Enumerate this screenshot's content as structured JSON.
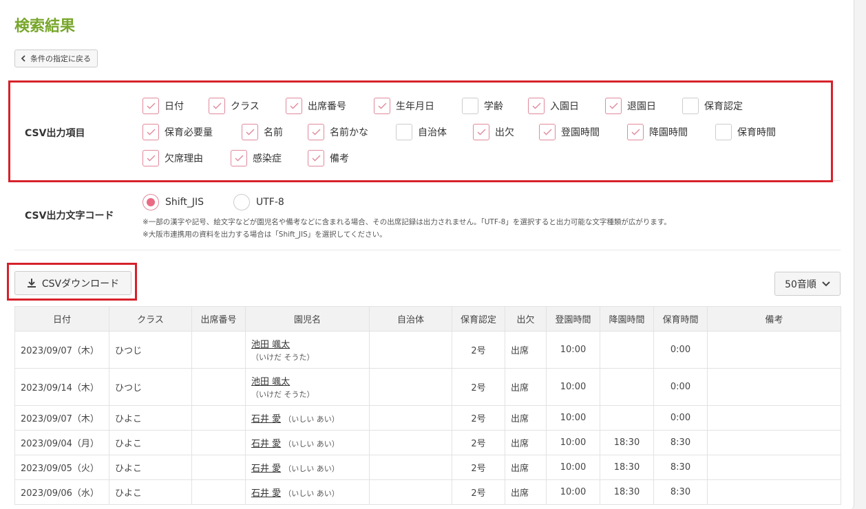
{
  "title": "検索結果",
  "back_label": "条件の指定に戻る",
  "csv_items": {
    "label": "CSV出力項目",
    "items": [
      {
        "label": "日付",
        "checked": true
      },
      {
        "label": "クラス",
        "checked": true
      },
      {
        "label": "出席番号",
        "checked": true
      },
      {
        "label": "生年月日",
        "checked": true
      },
      {
        "label": "学齢",
        "checked": false
      },
      {
        "label": "入園日",
        "checked": true
      },
      {
        "label": "退園日",
        "checked": true
      },
      {
        "label": "保育認定",
        "checked": false
      },
      {
        "label": "保育必要量",
        "checked": true
      },
      {
        "label": "名前",
        "checked": true
      },
      {
        "label": "名前かな",
        "checked": true
      },
      {
        "label": "自治体",
        "checked": false
      },
      {
        "label": "出欠",
        "checked": true
      },
      {
        "label": "登園時間",
        "checked": true
      },
      {
        "label": "降園時間",
        "checked": true
      },
      {
        "label": "保育時間",
        "checked": false
      },
      {
        "label": "欠席理由",
        "checked": true
      },
      {
        "label": "感染症",
        "checked": true
      },
      {
        "label": "備考",
        "checked": true
      }
    ]
  },
  "encoding": {
    "label": "CSV出力文字コード",
    "options": [
      {
        "label": "Shift_JIS",
        "selected": true
      },
      {
        "label": "UTF-8",
        "selected": false
      }
    ],
    "note1": "※一部の漢字や記号、絵文字などが園児名や備考などに含まれる場合、その出席記録は出力されません。「UTF-8」を選択すると出力可能な文字種類が広がります。",
    "note2": "※大阪市連携用の資料を出力する場合は「Shift_JIS」を選択してください。"
  },
  "download_label": "CSVダウンロード",
  "sort_label": "50音順",
  "table": {
    "headers": [
      "日付",
      "クラス",
      "出席番号",
      "園児名",
      "自治体",
      "保育認定",
      "出欠",
      "登園時間",
      "降園時間",
      "保育時間",
      "備考"
    ],
    "rows": [
      {
        "date": "2023/09/07（木）",
        "class": "ひつじ",
        "number": "",
        "name": "池田 颯太",
        "kana": "（いけだ そうた）",
        "city": "",
        "cert": "2号",
        "attendance": "出席",
        "arrive": "10:00",
        "leave": "",
        "hours": "0:00",
        "note": ""
      },
      {
        "date": "2023/09/14（木）",
        "class": "ひつじ",
        "number": "",
        "name": "池田 颯太",
        "kana": "（いけだ そうた）",
        "city": "",
        "cert": "2号",
        "attendance": "出席",
        "arrive": "10:00",
        "leave": "",
        "hours": "0:00",
        "note": ""
      },
      {
        "date": "2023/09/07（木）",
        "class": "ひよこ",
        "number": "",
        "name": "石井 愛",
        "kana": "（いしい あい）",
        "city": "",
        "cert": "2号",
        "attendance": "出席",
        "arrive": "10:00",
        "leave": "",
        "hours": "0:00",
        "note": ""
      },
      {
        "date": "2023/09/04（月）",
        "class": "ひよこ",
        "number": "",
        "name": "石井 愛",
        "kana": "（いしい あい）",
        "city": "",
        "cert": "2号",
        "attendance": "出席",
        "arrive": "10:00",
        "leave": "18:30",
        "hours": "8:30",
        "note": ""
      },
      {
        "date": "2023/09/05（火）",
        "class": "ひよこ",
        "number": "",
        "name": "石井 愛",
        "kana": "（いしい あい）",
        "city": "",
        "cert": "2号",
        "attendance": "出席",
        "arrive": "10:00",
        "leave": "18:30",
        "hours": "8:30",
        "note": ""
      },
      {
        "date": "2023/09/06（水）",
        "class": "ひよこ",
        "number": "",
        "name": "石井 愛",
        "kana": "（いしい あい）",
        "city": "",
        "cert": "2号",
        "attendance": "出席",
        "arrive": "10:00",
        "leave": "18:30",
        "hours": "8:30",
        "note": ""
      }
    ]
  },
  "colors": {
    "title": "#77a62a",
    "highlight": "#d6212a",
    "accent": "#ea6a84"
  }
}
